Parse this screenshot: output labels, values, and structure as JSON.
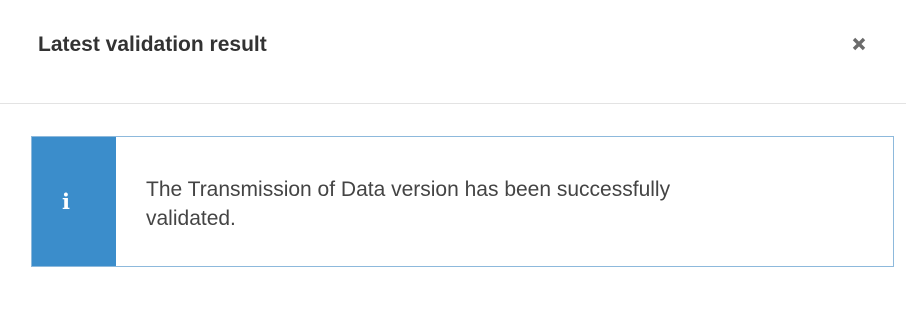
{
  "dialog": {
    "title": "Latest validation result",
    "close_icon": "close-icon"
  },
  "alert": {
    "type": "info",
    "icon": "info-icon",
    "icon_glyph": "i",
    "message": "The Transmission of Data version has been successfully validated.",
    "accent_color": "#3b8dcb",
    "border_color": "#8db9dc"
  }
}
